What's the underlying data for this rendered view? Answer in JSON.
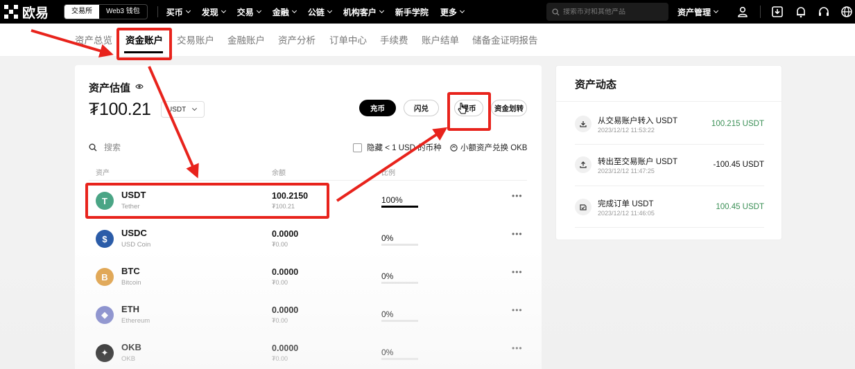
{
  "nav": {
    "logo": "欧易",
    "switch": [
      "交易所",
      "Web3 钱包"
    ],
    "items": [
      "买币",
      "发现",
      "交易",
      "金融",
      "公链",
      "机构客户",
      "新手学院",
      "更多"
    ],
    "search_placeholder": "搜索币对和其他产品",
    "asset_mgmt": "资产管理"
  },
  "tabs": [
    "资产总览",
    "资金账户",
    "交易账户",
    "金融账户",
    "资产分析",
    "订单中心",
    "手续费",
    "账户结单",
    "储备金证明报告"
  ],
  "overview": {
    "title": "资产估值",
    "balance": "₮100.21",
    "currency": "USDT",
    "buttons": {
      "deposit": "充币",
      "convert": "闪兑",
      "withdraw": "提币",
      "transfer": "资金划转"
    },
    "search_label": "搜索",
    "hide_small": "隐藏 < 1 USD 的币种",
    "small_convert": "小额资产兑换 OKB",
    "columns": {
      "asset": "资产",
      "balance": "余额",
      "ratio": "比例"
    }
  },
  "assets": [
    {
      "symbol": "USDT",
      "name": "Tether",
      "amount": "100.2150",
      "fiat": "₮100.21",
      "pct": "100%",
      "ratio": 1.0,
      "color": "#4aa585",
      "glyph": "T"
    },
    {
      "symbol": "USDC",
      "name": "USD Coin",
      "amount": "0.0000",
      "fiat": "₮0.00",
      "pct": "0%",
      "ratio": 0.0,
      "color": "#2b5ca8",
      "glyph": "$"
    },
    {
      "symbol": "BTC",
      "name": "Bitcoin",
      "amount": "0.0000",
      "fiat": "₮0.00",
      "pct": "0%",
      "ratio": 0.0,
      "color": "#e0a34c",
      "glyph": "B"
    },
    {
      "symbol": "ETH",
      "name": "Ethereum",
      "amount": "0.0000",
      "fiat": "₮0.00",
      "pct": "0%",
      "ratio": 0.0,
      "color": "#7b82c9",
      "glyph": "◆"
    },
    {
      "symbol": "OKB",
      "name": "OKB",
      "amount": "0.0000",
      "fiat": "₮0.00",
      "pct": "0%",
      "ratio": 0.0,
      "color": "#000000",
      "glyph": "✦"
    }
  ],
  "activity": {
    "title": "资产动态",
    "items": [
      {
        "title": "从交易账户转入 USDT",
        "time": "2023/12/12 11:53:22",
        "amount": "100.215 USDT",
        "color": "#3a8f55"
      },
      {
        "title": "转出至交易账户 USDT",
        "time": "2023/12/12 11:47:25",
        "amount": "-100.45 USDT",
        "color": "#111111"
      },
      {
        "title": "完成订单 USDT",
        "time": "2023/12/12 11:46:05",
        "amount": "100.45 USDT",
        "color": "#3a8f55"
      }
    ]
  },
  "highlight_color": "#e8231c"
}
